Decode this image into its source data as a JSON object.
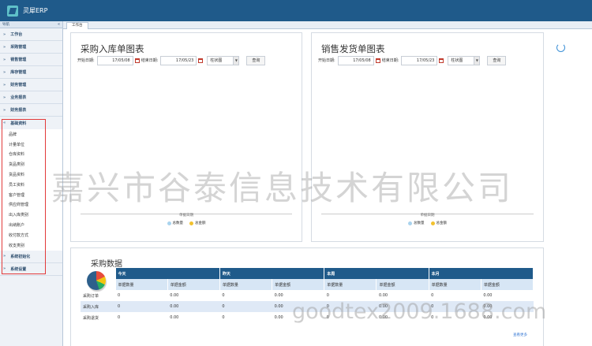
{
  "app": {
    "title": "灵犀ERP"
  },
  "sidebar": {
    "header": "导航",
    "collapse": "«",
    "groups_top": [
      "工作台",
      "采购管理",
      "销售管理",
      "库存管理",
      "财务管理",
      "业务报表",
      "财务报表"
    ],
    "open_group": "基础资料",
    "sub_items": [
      "品牌",
      "计量单位",
      "仓库资料",
      "货品类别",
      "货品资料",
      "员工资料",
      "客户管理",
      "供应商管理",
      "出入库类别",
      "出纳账户",
      "收付款方式",
      "收支类别"
    ],
    "groups_bottom": [
      "系统初始化",
      "系统设置"
    ]
  },
  "tabs": [
    "工作台"
  ],
  "purchase_chart": {
    "title": "采购入库单图表",
    "start_label": "开始日期:",
    "start_value": "17/05/08",
    "end_label": "结束日期:",
    "end_value": "17/05/23",
    "chart_type": "柱状图",
    "query": "查询",
    "x_title": "单据日期",
    "legend": [
      "总数量",
      "总金额"
    ]
  },
  "sales_chart": {
    "title": "销售发货单图表",
    "start_label": "开始日期:",
    "start_value": "17/05/08",
    "end_label": "结束日期:",
    "end_value": "17/05/23",
    "chart_type": "柱状图",
    "query": "查询",
    "x_title": "单据日期",
    "legend": [
      "总数量",
      "总金额"
    ]
  },
  "colors": {
    "qty": "#a9d3ee",
    "amount": "#f2c12e",
    "header": "#1f5a8a"
  },
  "purchase_data": {
    "title": "采购数据",
    "periods": [
      "今天",
      "昨天",
      "本周",
      "本月"
    ],
    "subheaders": [
      "单据数量",
      "单据金额"
    ],
    "rows": [
      {
        "label": "采购订单",
        "values": [
          "0",
          "0.00",
          "0",
          "0.00",
          "0",
          "0.00",
          "0",
          "0.00"
        ]
      },
      {
        "label": "采购入库",
        "values": [
          "0",
          "0.00",
          "0",
          "0.00",
          "0",
          "0.00",
          "0",
          "0.00"
        ]
      },
      {
        "label": "采购退货",
        "values": [
          "0",
          "0.00",
          "0",
          "0.00",
          "0",
          "0.00",
          "0",
          "0.00"
        ]
      }
    ],
    "more": "查看更多"
  },
  "watermark": {
    "line1": "嘉兴市谷泰信息技术有限公司",
    "line2": "goodtex2009.1688.com"
  }
}
